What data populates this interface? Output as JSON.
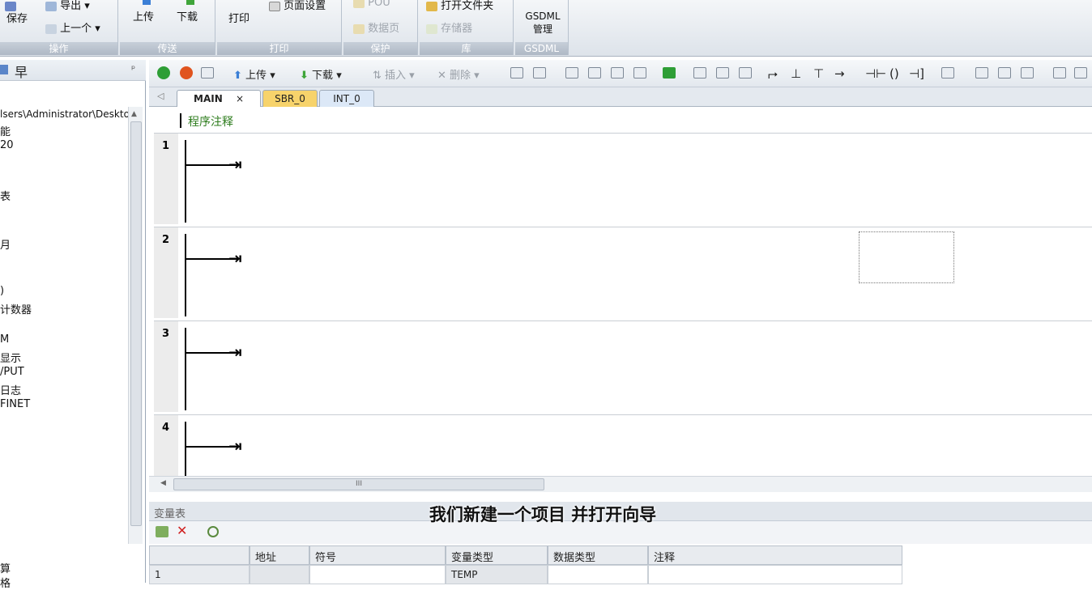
{
  "ribbon": {
    "groups": [
      {
        "caption": "操作",
        "buttons": [
          "保存",
          "导出",
          "上一个"
        ]
      },
      {
        "caption": "传送",
        "buttons": [
          "上传",
          "下载"
        ]
      },
      {
        "caption": "打印",
        "buttons": [
          "打印",
          "页面设置"
        ]
      },
      {
        "caption": "保护",
        "buttons": [
          "POU",
          "数据页"
        ]
      },
      {
        "caption": "库",
        "buttons": [
          "打开文件夹",
          "存储器"
        ]
      },
      {
        "caption": "GSDML",
        "buttons": [
          "GSDML管理"
        ]
      }
    ]
  },
  "left_panel": {
    "head_glyph": "早",
    "pin": "ᵖ",
    "items": [
      "lsers\\Administrator\\Deskto",
      "能",
      "20",
      "表",
      "月",
      ")",
      "计数器",
      "M",
      "显示",
      "/PUT",
      "日志",
      "FINET",
      "算",
      "格"
    ]
  },
  "editor": {
    "toolbar": {
      "upload": "上传",
      "download": "下载",
      "insert": "插入",
      "delete": "删除"
    },
    "tabs": [
      {
        "label": "MAIN",
        "active": true,
        "close": "×"
      },
      {
        "label": "SBR_0",
        "active": false
      },
      {
        "label": "INT_0",
        "active": false
      }
    ],
    "program_comment": "程序注释",
    "networks": [
      "1",
      "2",
      "3",
      "4"
    ],
    "scroll_grip": "III"
  },
  "variable_table": {
    "title": "变量表",
    "columns": [
      "",
      "地址",
      "符号",
      "变量类型",
      "数据类型",
      "注释"
    ],
    "rows": [
      {
        "index": "1",
        "address": "",
        "symbol": "",
        "var_type": "TEMP",
        "data_type": "",
        "comment": ""
      }
    ]
  },
  "subtitle": "我们新建一个项目 并打开向导",
  "colors": {
    "active_tab": "#ffffff",
    "sbr_tab": "#f7d36b",
    "int_tab": "#dce8f7",
    "comment_green": "#2e7d1e"
  }
}
